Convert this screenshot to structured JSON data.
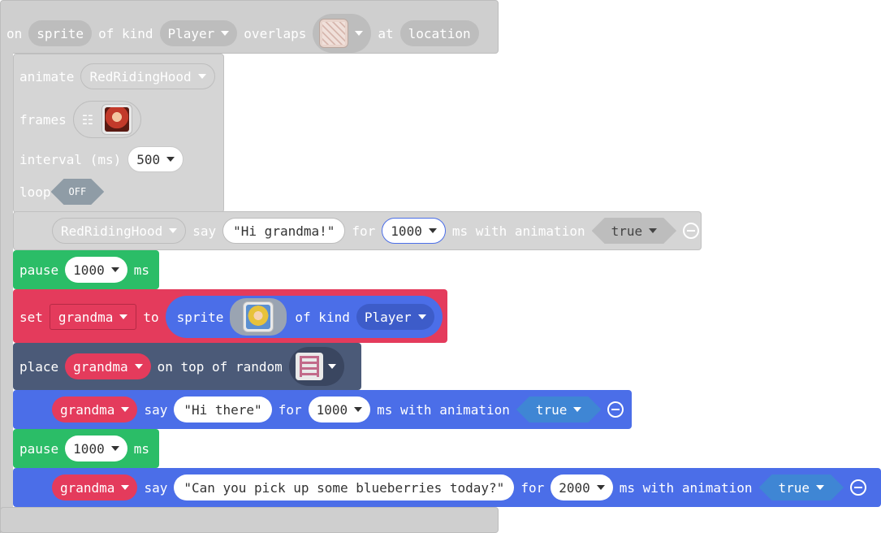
{
  "event": {
    "on": "on",
    "sprite_param": "sprite",
    "of_kind": "of kind",
    "kind": "Player",
    "overlaps": "overlaps",
    "at": "at",
    "location_param": "location"
  },
  "animate": {
    "label": "animate",
    "target": "RedRidingHood",
    "frames_label": "frames",
    "interval_label": "interval (ms)",
    "interval_value": "500",
    "loop_label": "loop",
    "loop_value": "OFF"
  },
  "say1": {
    "target": "RedRidingHood",
    "say": "say",
    "text": "Hi grandma!",
    "for": "for",
    "ms": "1000",
    "ms_label": "ms with animation",
    "anim": "true"
  },
  "pause1": {
    "label": "pause",
    "value": "1000",
    "unit": "ms"
  },
  "set": {
    "label": "set",
    "var": "grandma",
    "to": "to",
    "sprite": "sprite",
    "of_kind": "of kind",
    "kind": "Player"
  },
  "place": {
    "label": "place",
    "var": "grandma",
    "on_top": "on top of random"
  },
  "say2": {
    "target": "grandma",
    "say": "say",
    "text": "Hi there",
    "for": "for",
    "ms": "1000",
    "ms_label": "ms with animation",
    "anim": "true"
  },
  "pause2": {
    "label": "pause",
    "value": "1000",
    "unit": "ms"
  },
  "say3": {
    "target": "grandma",
    "say": "say",
    "text": "Can you pick up some blueberries today?",
    "for": "for",
    "ms": "2000",
    "ms_label": "ms with animation",
    "anim": "true"
  },
  "colors": {
    "event_gray": "#cfcfcf",
    "pause_green": "#2bbd67",
    "set_red": "#e43b5c",
    "sprite_blue": "#4b6ee8",
    "place_slate": "#4b5a78"
  }
}
